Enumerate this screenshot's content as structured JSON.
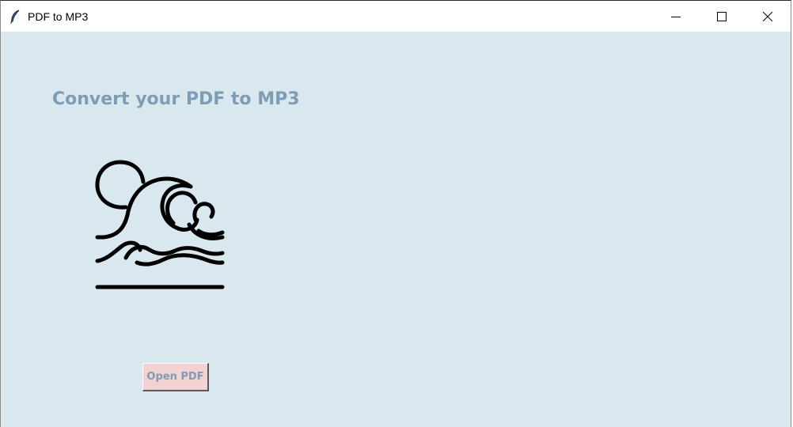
{
  "window": {
    "title": "PDF to MP3",
    "app_icon": "feather-icon",
    "controls": [
      "minimize-icon",
      "maximize-icon",
      "close-icon"
    ]
  },
  "main": {
    "heading": "Convert your PDF to MP3",
    "image_icon": "ocean-wave-icon",
    "open_button_label": "Open PDF"
  },
  "colors": {
    "background": "#d9e8ef",
    "heading_text": "#7e9cb4",
    "button_background": "#f2d2d3"
  }
}
